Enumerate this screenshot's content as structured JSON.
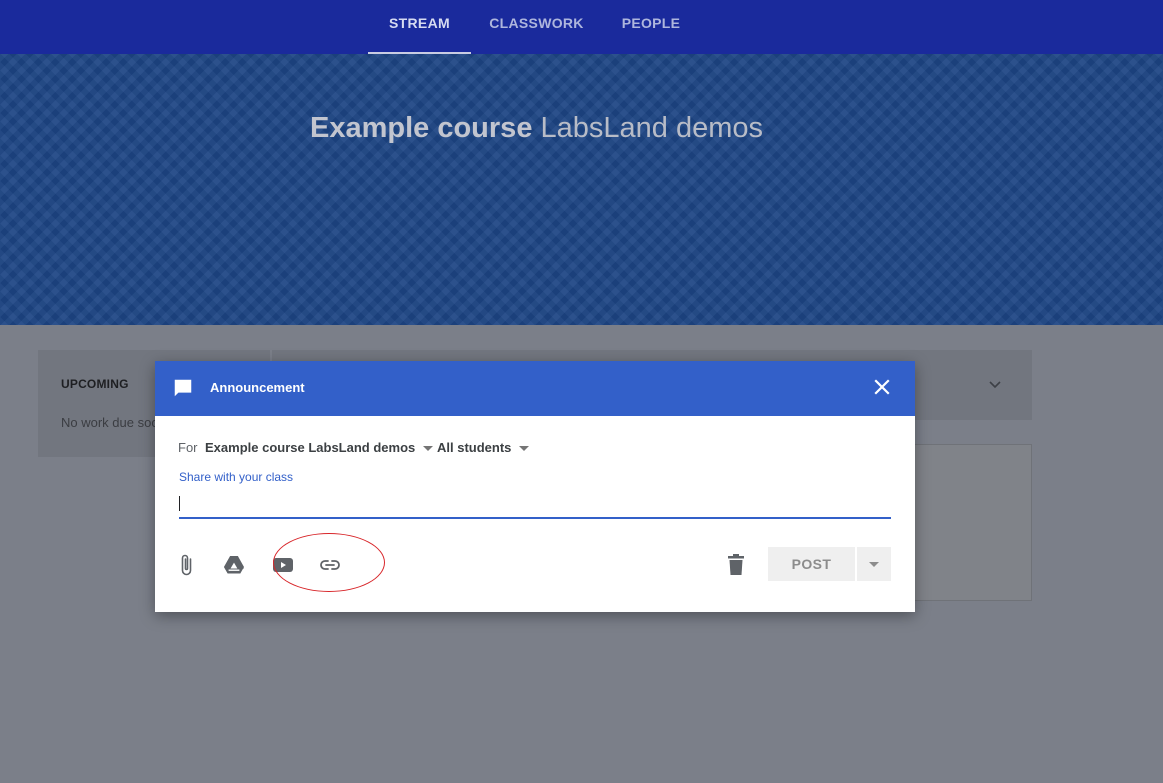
{
  "nav": {
    "tabs": [
      {
        "label": "STREAM",
        "active": true
      },
      {
        "label": "CLASSWORK",
        "active": false
      },
      {
        "label": "PEOPLE",
        "active": false
      }
    ]
  },
  "banner": {
    "course_name": "Example course",
    "section": "LabsLand demos"
  },
  "sidebar": {
    "upcoming_title": "UPCOMING",
    "upcoming_text": "No work due soon"
  },
  "dialog": {
    "title": "Announcement",
    "for_label": "For",
    "course_select": "Example course LabsLand demos",
    "audience_select": "All students",
    "share_label": "Share with your class",
    "text_value": "",
    "post_label": "POST",
    "icons": [
      "announcement-icon",
      "close-icon",
      "attach-icon",
      "drive-icon",
      "youtube-icon",
      "link-icon",
      "trash-icon",
      "caret-down-icon"
    ]
  },
  "colors": {
    "topbar": "#1a2a9c",
    "banner": "#1d4584",
    "dialog_header": "#3360c9",
    "highlight": "#d8262a"
  }
}
